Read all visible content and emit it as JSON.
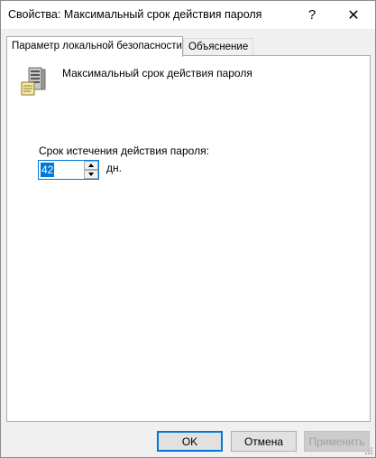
{
  "window": {
    "title": "Свойства: Максимальный срок действия пароля",
    "help_glyph": "?",
    "close_glyph": "✕"
  },
  "tabs": [
    {
      "label": "Параметр локальной безопасности",
      "active": true
    },
    {
      "label": "Объяснение",
      "active": false
    }
  ],
  "policy": {
    "icon": "server-icon",
    "name": "Максимальный срок действия пароля"
  },
  "field": {
    "label": "Срок истечения действия пароля:",
    "value": "42",
    "units": "дн."
  },
  "buttons": {
    "ok": "OK",
    "cancel": "Отмена",
    "apply": "Применить"
  },
  "colors": {
    "accent": "#0078d7",
    "disabled_text": "#a0a0a0"
  }
}
